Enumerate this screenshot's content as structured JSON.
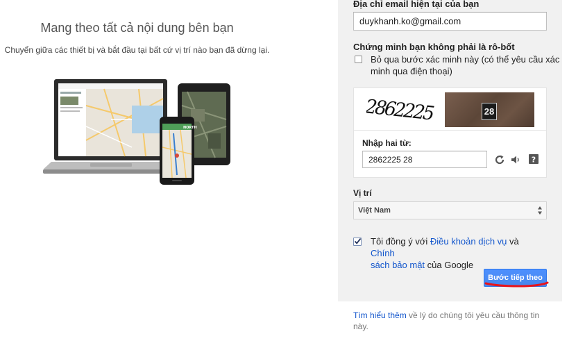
{
  "left": {
    "title": "Mang theo tất cả nội dung bên bạn",
    "subtitle": "Chuyển giữa các thiết bị và bắt đầu tại bất cứ vị trí nào bạn đã dừng lại.",
    "phone_sign": "NORTH"
  },
  "form": {
    "email_label": "Địa chỉ email hiện tại của bạn",
    "email_value": "duykhanh.ko@gmail.com",
    "robot_label": "Chứng minh bạn không phải là rô-bốt",
    "skip_line1": "Bỏ qua bước xác minh này (có thể yêu cầu xác",
    "skip_line2": "minh qua điện thoại)",
    "captcha": {
      "image1_text": "2862225",
      "image2_text": "28",
      "input_label": "Nhập hai từ:",
      "input_value": "2862225 28",
      "icons": [
        "refresh-icon",
        "audio-icon",
        "help-icon"
      ]
    },
    "location_label": "Vị trí",
    "location_value": "Việt Nam",
    "terms": {
      "prefix": "Tôi đồng ý với ",
      "tos_link": "Điều khoản dịch vụ",
      "and": " và ",
      "privacy_link_1": "Chính",
      "privacy_link_2": "sách bảo mật",
      "suffix": " của Google",
      "checked": true
    },
    "next_button": "Bước tiếp theo"
  },
  "footer": {
    "learn_more_link": "Tìm hiểu thêm",
    "learn_more_text": " về lý do chúng tôi yêu cầu thông tin này."
  },
  "colors": {
    "panel_bg": "#f1f1f1",
    "button_blue": "#4d90fe",
    "link_blue": "#1155cc",
    "annotation_red": "#e8141c"
  }
}
